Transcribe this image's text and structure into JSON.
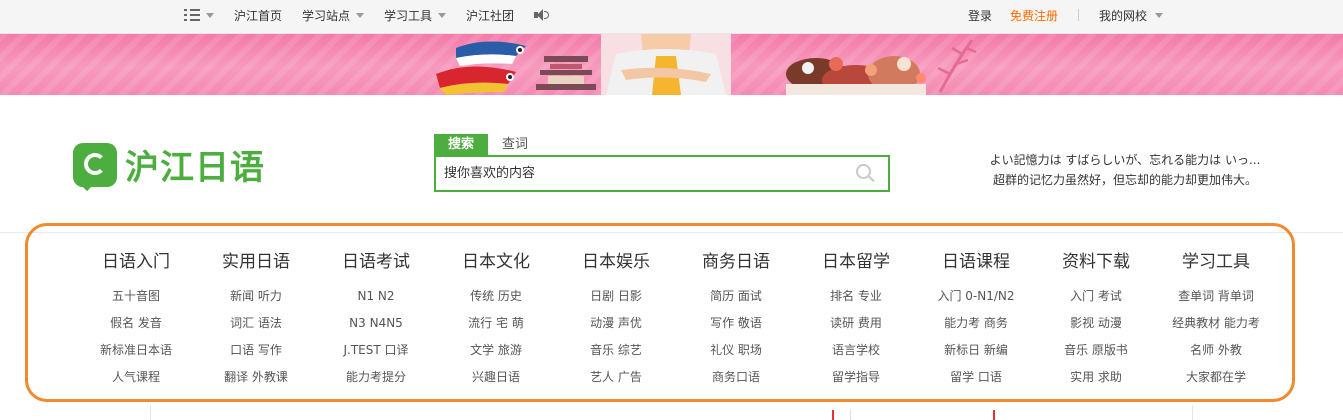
{
  "topbar": {
    "left_items": [
      {
        "label": "",
        "icon": "menu-icon",
        "dropdown": true
      },
      {
        "label": "沪江首页",
        "dropdown": false
      },
      {
        "label": "学习站点",
        "dropdown": true
      },
      {
        "label": "学习工具",
        "dropdown": true
      },
      {
        "label": "沪江社团",
        "dropdown": false
      }
    ],
    "sound_icon": "speaker-icon",
    "login": "登录",
    "register": "免费注册",
    "my_school": "我的网校"
  },
  "logo": {
    "text": "沪江日语",
    "color": "#4cae3f"
  },
  "search": {
    "tabs": [
      "搜索",
      "查词"
    ],
    "active_tab": "搜索",
    "placeholder": "搜你喜欢的内容",
    "border_color": "#4cae3f"
  },
  "slogan": {
    "line1": "よい記憶力は すばらしいが、忘れる能力は いっ...",
    "line2": "超群的记忆力虽然好，但忘却的能力却更加伟大。"
  },
  "nav": {
    "highlight_color": "#f08a2c",
    "columns": [
      {
        "title": "日语入门",
        "links": [
          "五十音图",
          "假名 发音",
          "新标准日本语",
          "人气课程"
        ]
      },
      {
        "title": "实用日语",
        "links": [
          "新闻 听力",
          "词汇 语法",
          "口语 写作",
          "翻译 外教课"
        ]
      },
      {
        "title": "日语考试",
        "links": [
          "N1 N2",
          "N3 N4N5",
          "J.TEST 口译",
          "能力考提分"
        ]
      },
      {
        "title": "日本文化",
        "links": [
          "传统 历史",
          "流行 宅 萌",
          "文学 旅游",
          "兴趣日语"
        ]
      },
      {
        "title": "日本娱乐",
        "links": [
          "日剧 日影",
          "动漫 声优",
          "音乐 综艺",
          "艺人 广告"
        ]
      },
      {
        "title": "商务日语",
        "links": [
          "简历 面试",
          "写作 敬语",
          "礼仪 职场",
          "商务口语"
        ]
      },
      {
        "title": "日本留学",
        "links": [
          "排名 专业",
          "读研 费用",
          "语言学校",
          "留学指导"
        ]
      },
      {
        "title": "日语课程",
        "links": [
          "入门 0-N1/N2",
          "能力考 商务",
          "新标日 新编",
          "留学 口语"
        ]
      },
      {
        "title": "资料下载",
        "links": [
          "入门 考试",
          "影视 动漫",
          "音乐 原版书",
          "实用 求助"
        ]
      },
      {
        "title": "学习工具",
        "links": [
          "查单词 背单词",
          "经典教材 能力考",
          "名师 外教",
          "大家都在学"
        ]
      }
    ]
  }
}
